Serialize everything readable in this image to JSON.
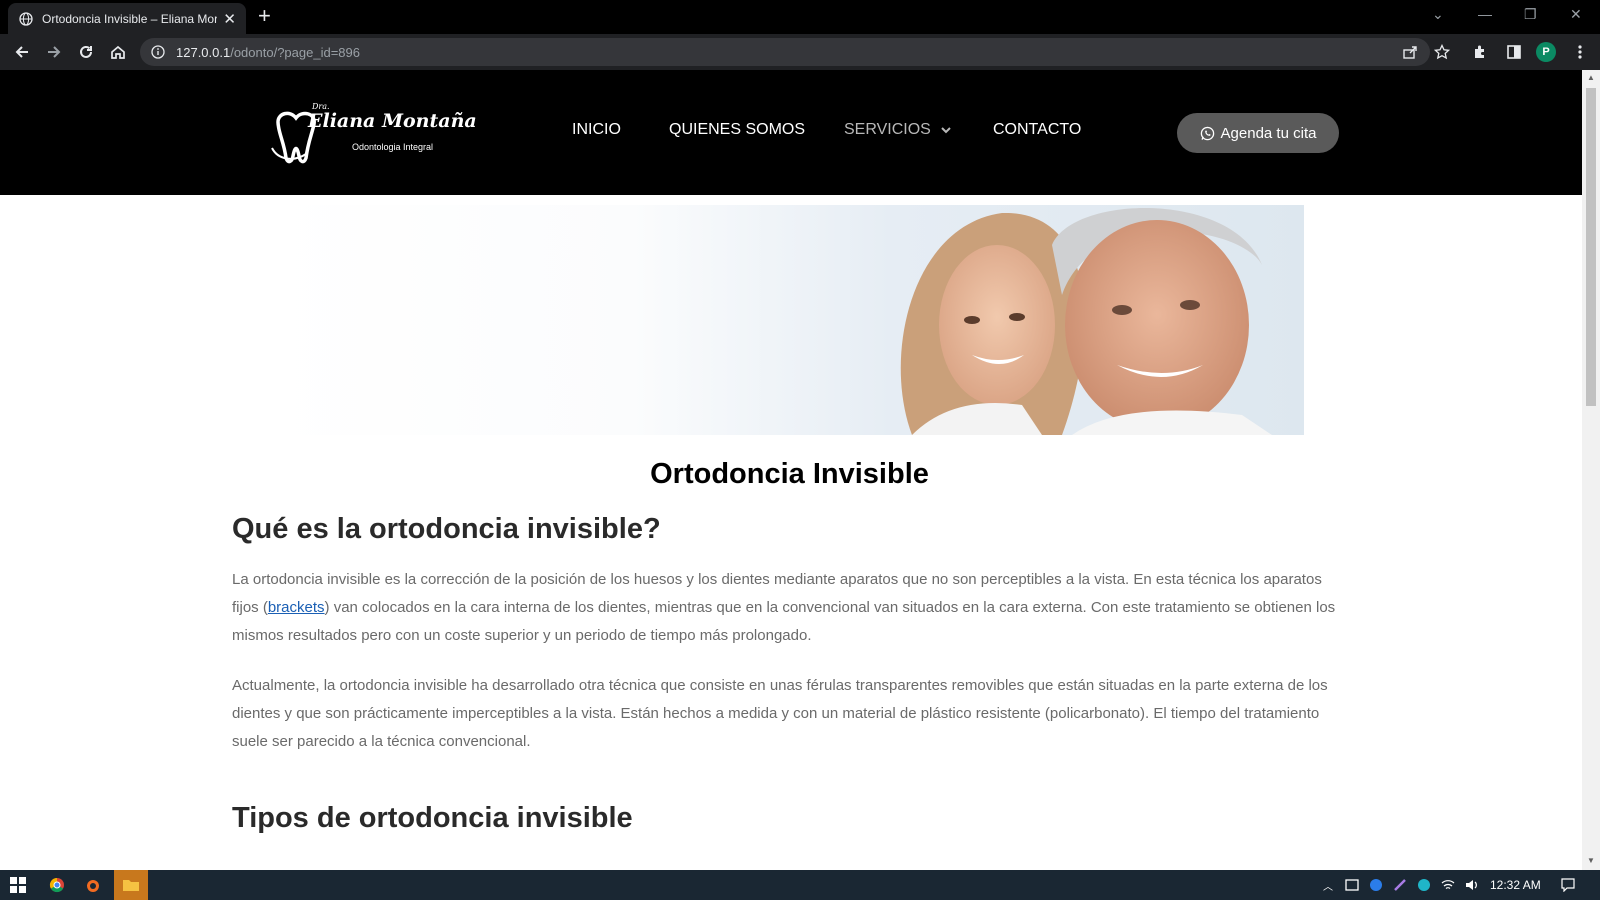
{
  "browser": {
    "tab_title": "Ortodoncia Invisible – Eliana Mor",
    "url_host": "127.0.0.1",
    "url_path": "/odonto/?page_id=896",
    "profile_initial": "P"
  },
  "site": {
    "logo": {
      "prefix": "Dra.",
      "name": "Eliana Montaña",
      "tagline": "Odontologia Integral"
    },
    "nav": [
      {
        "label": "INICIO"
      },
      {
        "label": "QUIENES SOMOS"
      },
      {
        "label": "SERVICIOS"
      },
      {
        "label": "CONTACTO"
      }
    ],
    "cta_label": "Agenda tu cita"
  },
  "page": {
    "title": "Ortodoncia Invisible",
    "section1_heading": "Qué es la ortodoncia invisible?",
    "p1_before": "La ortodoncia invisible es la corrección de la posición de los huesos y los dientes mediante aparatos que no son perceptibles a la vista. En esta técnica los aparatos fijos (",
    "p1_link": "brackets",
    "p1_after": ") van colocados en la cara interna de los dientes, mientras que en la convencional van situados en la cara externa. Con este tratamiento se obtienen los mismos resultados pero con un coste superior y un periodo de tiempo más prolongado.",
    "p2": "Actualmente, la ortodoncia invisible ha desarrollado otra técnica que consiste en unas férulas transparentes removibles que están situadas en la parte externa de los dientes y que son prácticamente imperceptibles a la vista. Están hechos a medida y con un material de plástico resistente (policarbonato). El tiempo del tratamiento suele ser parecido a la técnica convencional.",
    "section2_heading": "Tipos de ortodoncia invisible"
  },
  "taskbar": {
    "time": "12:32 AM"
  }
}
